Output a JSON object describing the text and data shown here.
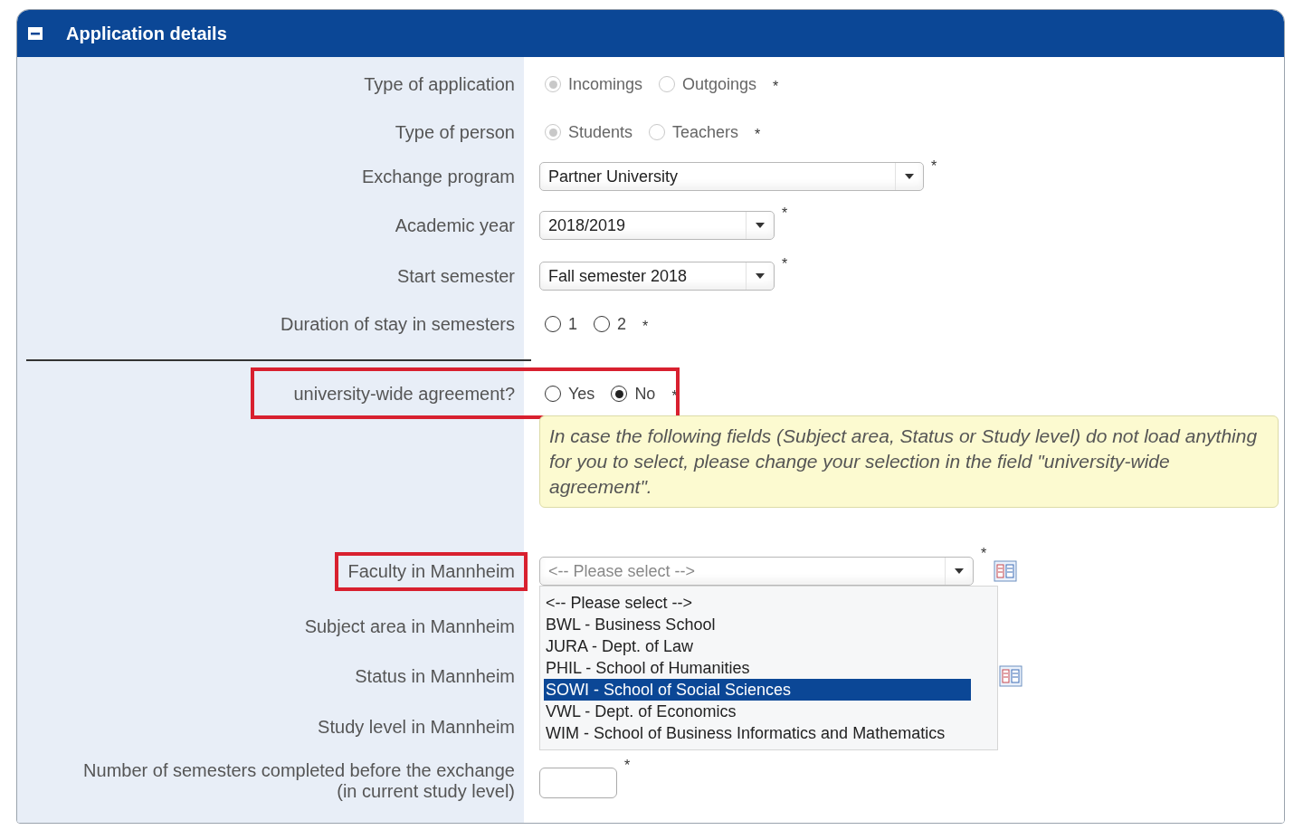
{
  "section": {
    "title": "Application details",
    "expanded": true
  },
  "fields": [
    {
      "kind": "radio",
      "label": "Type of application",
      "disabled": true,
      "required": "*",
      "options": [
        {
          "label": "Incomings",
          "selected": true
        },
        {
          "label": "Outgoings",
          "selected": false
        }
      ]
    },
    {
      "kind": "radio",
      "label": "Type of person",
      "disabled": true,
      "required": "*",
      "options": [
        {
          "label": "Students",
          "selected": true
        },
        {
          "label": "Teachers",
          "selected": false
        }
      ]
    },
    {
      "kind": "select",
      "label": "Exchange program",
      "value": "Partner University",
      "required": "*"
    },
    {
      "kind": "select",
      "label": "Academic year",
      "value": "2018/2019",
      "required": "*"
    },
    {
      "kind": "select",
      "label": "Start semester",
      "value": "Fall semester 2018",
      "required": "*"
    },
    {
      "kind": "radio",
      "label": "Duration of stay in semesters",
      "disabled": false,
      "required": "*",
      "options": [
        {
          "label": "1",
          "selected": false
        },
        {
          "label": "2",
          "selected": false
        }
      ]
    },
    {
      "kind": "divider"
    },
    {
      "kind": "radio",
      "label": "university-wide agreement?",
      "disabled": false,
      "highlighted": true,
      "required": "*",
      "options": [
        {
          "label": "Yes",
          "selected": false
        },
        {
          "label": "No",
          "selected": true
        }
      ]
    },
    {
      "kind": "note",
      "text": "In case the following fields (Subject area, Status or Study level) do not load anything for you to select, please change your selection in the field \"university-wide agreement\"."
    },
    {
      "kind": "select",
      "label": "Faculty in Mannheim",
      "placeholder": "<-- Please select -->",
      "highlighted": true,
      "required": "*",
      "lookup": true,
      "expanded": true,
      "options": [
        {
          "label": "<-- Please select -->",
          "selected": false
        },
        {
          "label": "BWL - Business School",
          "selected": false
        },
        {
          "label": "JURA - Dept. of Law",
          "selected": false
        },
        {
          "label": "PHIL - School of Humanities",
          "selected": false
        },
        {
          "label": "SOWI - School of Social Sciences",
          "selected": true
        },
        {
          "label": "VWL - Dept. of Economics",
          "selected": false
        },
        {
          "label": "WIM - School of Business Informatics and Mathematics",
          "selected": false
        }
      ]
    },
    {
      "kind": "covered",
      "label": "Subject area in Mannheim"
    },
    {
      "kind": "covered",
      "label": "Status in Mannheim",
      "lookup": true
    },
    {
      "kind": "covered",
      "label": "Study level in Mannheim"
    },
    {
      "kind": "text",
      "label": "Number of semesters completed before the exchange",
      "sublabel": "(in current study level)",
      "required": "*"
    }
  ]
}
